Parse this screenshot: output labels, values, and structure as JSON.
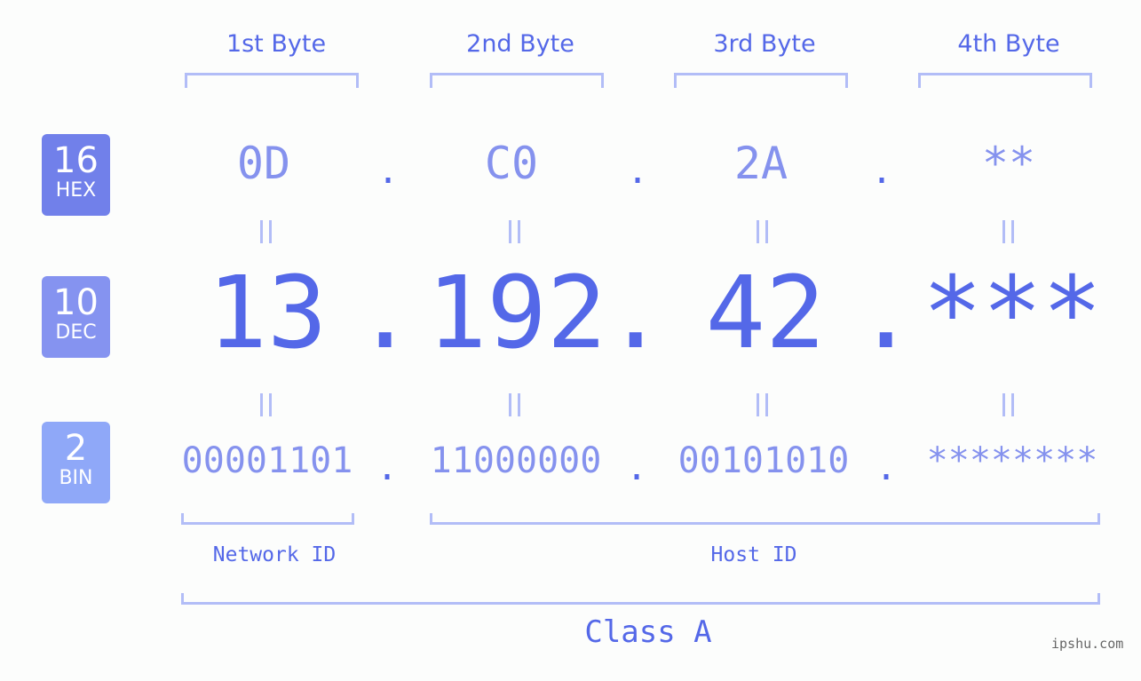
{
  "byte_headers": [
    "1st Byte",
    "2nd Byte",
    "3rd Byte",
    "4th Byte"
  ],
  "badges": [
    {
      "number": "16",
      "label": "HEX",
      "color": "#7180ea"
    },
    {
      "number": "10",
      "label": "DEC",
      "color": "#8593f0"
    },
    {
      "number": "2",
      "label": "BIN",
      "color": "#8fa8f8"
    }
  ],
  "hex": [
    "0D",
    "C0",
    "2A",
    "**"
  ],
  "dec": [
    "13",
    "192",
    "42",
    "***"
  ],
  "bin": [
    "00001101",
    "11000000",
    "00101010",
    "********"
  ],
  "separator": ".",
  "network_label": "Network ID",
  "host_label": "Host ID",
  "class_label": "Class A",
  "watermark": "ipshu.com",
  "colors": {
    "primary": "#5468e8",
    "light": "#8592ee",
    "bracket": "#b2bdf7"
  }
}
